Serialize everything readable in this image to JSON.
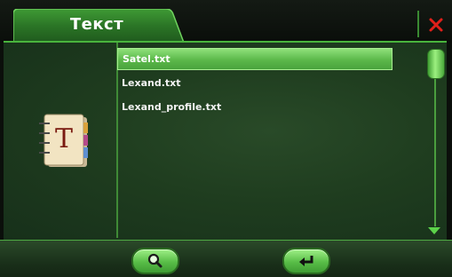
{
  "header": {
    "title": "Текст"
  },
  "icons": {
    "close": "close-icon",
    "document": "text-document-icon",
    "search": "magnifier-icon",
    "back": "return-arrow-icon"
  },
  "files": [
    {
      "name": "Satel.txt",
      "selected": true
    },
    {
      "name": "Lexand.txt",
      "selected": false
    },
    {
      "name": "Lexand_profile.txt",
      "selected": false
    }
  ],
  "colors": {
    "accent": "#49b43d",
    "selection": "#5bb84a",
    "close": "#e0201a",
    "panel": "#1f3d1f"
  }
}
